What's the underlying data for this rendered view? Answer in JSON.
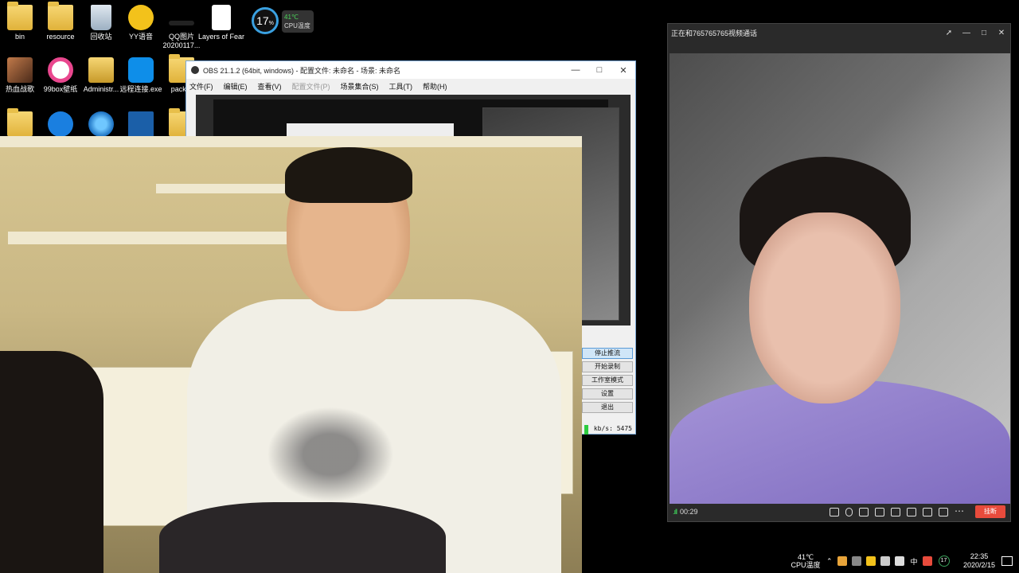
{
  "desktop": {
    "icons": [
      {
        "label": "bin",
        "icon": "bin-folder-icon"
      },
      {
        "label": "resource",
        "icon": "folder-icon"
      },
      {
        "label": "回收站",
        "icon": "recycle-bin-icon"
      },
      {
        "label": "YY语音",
        "icon": "yy-icon"
      },
      {
        "label": "QQ图片20200117...",
        "icon": "image-file-icon"
      },
      {
        "label": "Layers of Fear",
        "icon": "document-icon"
      },
      {
        "label": "热血战歌",
        "icon": "game-icon"
      },
      {
        "label": "99box壁纸",
        "icon": "99box-icon"
      },
      {
        "label": "Administr...",
        "icon": "folder-icon"
      },
      {
        "label": "远程连接.exe",
        "icon": "teamviewer-icon"
      },
      {
        "label": "pack...",
        "icon": "folder-icon"
      }
    ]
  },
  "cpu_widget": {
    "usage": "17",
    "usage_unit": "%",
    "temp": "41℃",
    "temp_label": "CPU温度"
  },
  "obs": {
    "title": "OBS 21.1.2 (64bit, windows) - 配置文件: 未命名 - 场景: 未命名",
    "menu": [
      "文件(F)",
      "编辑(E)",
      "查看(V)",
      "配置文件(P)",
      "场景集合(S)",
      "工具(T)",
      "帮助(H)"
    ],
    "controls": [
      "停止推流",
      "开始录制",
      "工作室模式",
      "设置",
      "退出"
    ],
    "status": "kb/s: 5475"
  },
  "call": {
    "title": "正在和765765765视频通话",
    "duration": "00:29",
    "hangup": "挂断"
  },
  "tray": {
    "cpu_temp": "41℃",
    "cpu_label": "CPU温度",
    "ime": "中",
    "badge": "17",
    "time": "22:35",
    "date": "2020/2/15"
  }
}
